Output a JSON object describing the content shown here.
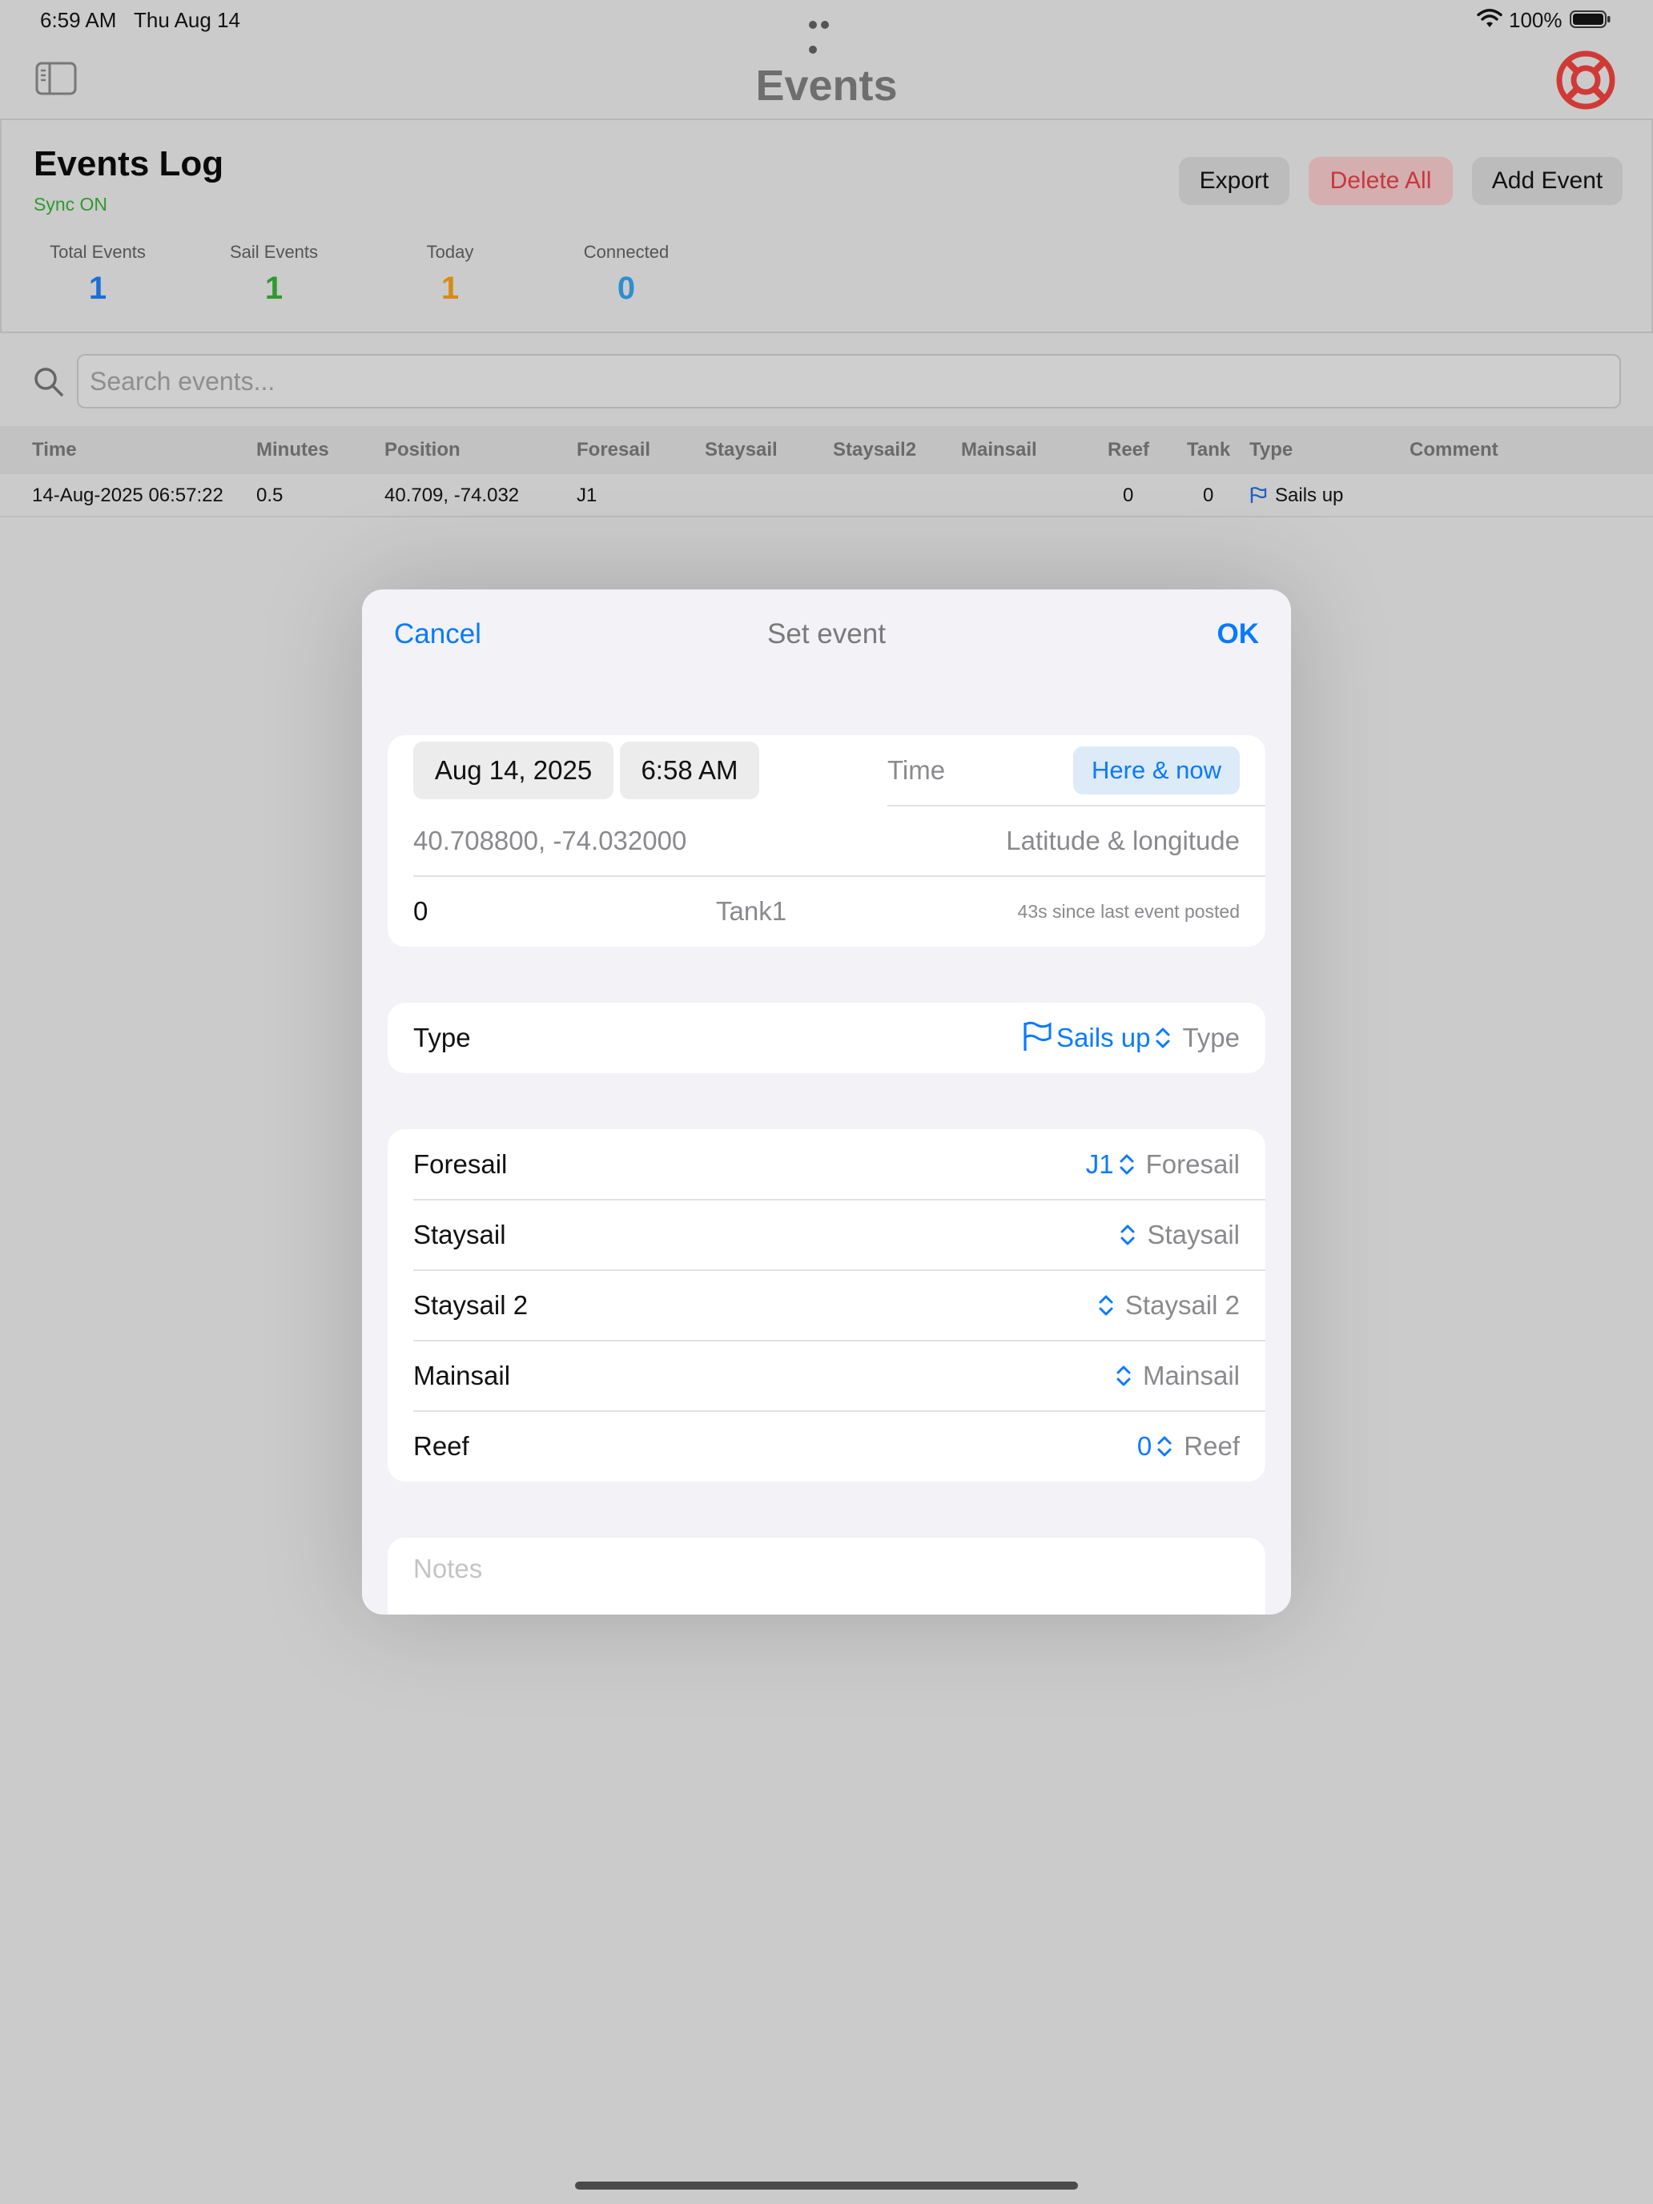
{
  "status_bar": {
    "time": "6:59 AM",
    "date": "Thu Aug 14",
    "battery": "100%"
  },
  "nav": {
    "title": "Events"
  },
  "log": {
    "title": "Events Log",
    "sync": "Sync ON",
    "buttons": {
      "export": "Export",
      "delete_all": "Delete All",
      "add_event": "Add Event"
    },
    "stats": [
      {
        "label": "Total Events",
        "value": "1",
        "color": "#1a6fd6"
      },
      {
        "label": "Sail Events",
        "value": "1",
        "color": "#2f9a2f"
      },
      {
        "label": "Today",
        "value": "1",
        "color": "#d98a12"
      },
      {
        "label": "Connected",
        "value": "0",
        "color": "#2c8fcf"
      }
    ]
  },
  "search": {
    "placeholder": "Search events..."
  },
  "table": {
    "columns": [
      "Time",
      "Minutes",
      "Position",
      "Foresail",
      "Staysail",
      "Staysail2",
      "Mainsail",
      "Reef",
      "Tank",
      "Type",
      "Comment"
    ],
    "rows": [
      {
        "time": "14-Aug-2025 06:57:22",
        "minutes": "0.5",
        "position": "40.709, -74.032",
        "foresail": "J1",
        "staysail": "",
        "staysail2": "",
        "mainsail": "",
        "reef": "0",
        "tank": "0",
        "type": "Sails up",
        "comment": ""
      }
    ]
  },
  "modal": {
    "cancel": "Cancel",
    "title": "Set event",
    "ok": "OK",
    "date": "Aug 14, 2025",
    "time": "6:58 AM",
    "time_label": "Time",
    "here_now": "Here & now",
    "coords": "40.708800, -74.032000",
    "coords_label": "Latitude & longitude",
    "tank_value": "0",
    "tank_label": "Tank1",
    "since_last": "43s since last event posted",
    "type_row": {
      "label": "Type",
      "value": "Sails up",
      "hint": "Type"
    },
    "sails": [
      {
        "label": "Foresail",
        "value": "J1",
        "hint": "Foresail"
      },
      {
        "label": "Staysail",
        "value": "",
        "hint": "Staysail"
      },
      {
        "label": "Staysail 2",
        "value": "",
        "hint": "Staysail 2"
      },
      {
        "label": "Mainsail",
        "value": "",
        "hint": "Mainsail"
      },
      {
        "label": "Reef",
        "value": "0",
        "hint": "Reef"
      }
    ],
    "notes_placeholder": "Notes"
  }
}
